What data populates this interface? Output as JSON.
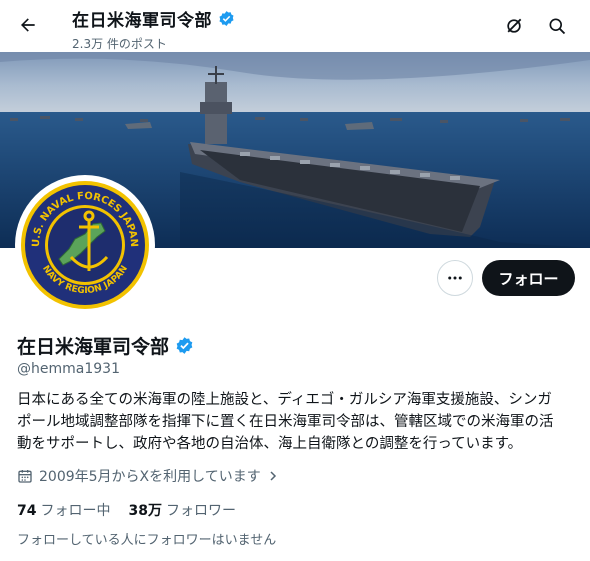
{
  "header": {
    "title": "在日米海軍司令部",
    "post_count": "2.3万 件のポスト",
    "back_icon": "arrow-left-icon",
    "grok_icon": "grok-icon",
    "search_icon": "search-icon"
  },
  "banner": {
    "description_icon": "aircraft-carrier-photo"
  },
  "avatar": {
    "ring_text_top": "U.S. NAVAL FORCES JAPAN",
    "ring_text_bottom": "NAVY REGION JAPAN"
  },
  "actions": {
    "more_icon": "more-icon",
    "follow_label": "フォロー"
  },
  "profile": {
    "name": "在日米海軍司令部",
    "handle": "@hemma1931",
    "bio_line1": "日本にある全ての米海軍の陸上施設と、ディエゴ・ガルシア海軍支援施設、シンガ",
    "bio_line2": "ポール地域調整部隊を指揮下に置く在日米海軍司令部は、管轄区域での米海軍の活",
    "bio_line3": "動をサポートし、政府や各地の自治体、海上自衛隊との調整を行っています。",
    "joined": "2009年5月からXを利用しています",
    "following_count": "74",
    "following_label": "フォロー中",
    "followers_count": "38万",
    "followers_label": "フォロワー",
    "followers_note": "フォローしている人にフォロワーはいません"
  },
  "colors": {
    "verified": "#1d9bf0",
    "follow_button": "#0f1419",
    "secondary_text": "#536471"
  }
}
